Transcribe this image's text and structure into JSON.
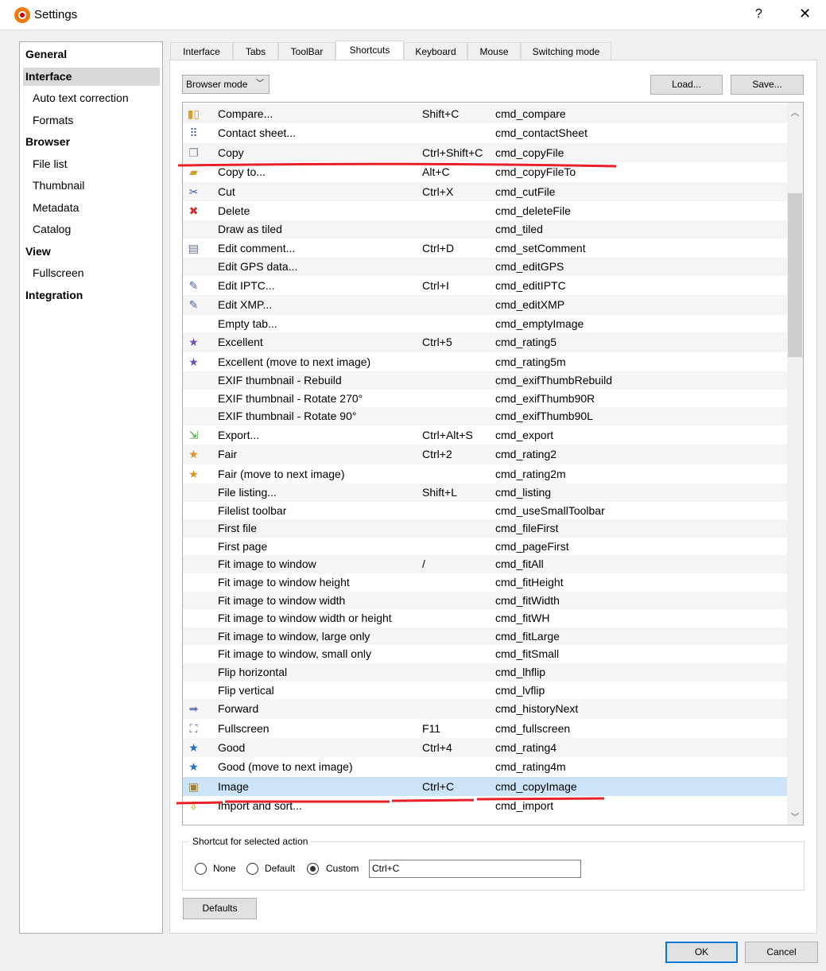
{
  "window": {
    "title": "Settings",
    "help": "?",
    "close": "✕"
  },
  "sidebar": {
    "items": [
      {
        "label": "General",
        "type": "h"
      },
      {
        "label": "Interface",
        "type": "h",
        "selected": true
      },
      {
        "label": "Auto text correction",
        "type": "s"
      },
      {
        "label": "Formats",
        "type": "s"
      },
      {
        "label": "Browser",
        "type": "h"
      },
      {
        "label": "File list",
        "type": "s"
      },
      {
        "label": "Thumbnail",
        "type": "s"
      },
      {
        "label": "Metadata",
        "type": "s"
      },
      {
        "label": "Catalog",
        "type": "s"
      },
      {
        "label": "View",
        "type": "h"
      },
      {
        "label": "Fullscreen",
        "type": "s"
      },
      {
        "label": "Integration",
        "type": "h"
      }
    ]
  },
  "tabs": [
    "Interface",
    "Tabs",
    "ToolBar",
    "Shortcuts",
    "Keyboard",
    "Mouse",
    "Switching mode"
  ],
  "active_tab": "Shortcuts",
  "mode_dropdown": {
    "value": "Browser mode"
  },
  "load_label": "Load...",
  "save_label": "Save...",
  "shortcuts": [
    {
      "name": "Compare...",
      "shortcut": "Shift+C",
      "command": "cmd_compare",
      "icon": "compare-icon",
      "glyph": "▮▯",
      "color": "#e0a020"
    },
    {
      "name": "Contact sheet...",
      "shortcut": "",
      "command": "cmd_contactSheet",
      "icon": "contact-sheet-icon",
      "glyph": "⠿",
      "color": "#5060b0"
    },
    {
      "name": "Copy",
      "shortcut": "Ctrl+Shift+C",
      "command": "cmd_copyFile",
      "icon": "copy-icon",
      "glyph": "❐",
      "color": "#8090a0"
    },
    {
      "name": "Copy to...",
      "shortcut": "Alt+C",
      "command": "cmd_copyFileTo",
      "icon": "copy-to-icon",
      "glyph": "▰",
      "color": "#d0a030"
    },
    {
      "name": "Cut",
      "shortcut": "Ctrl+X",
      "command": "cmd_cutFile",
      "icon": "scissors-icon",
      "glyph": "✂",
      "color": "#4060a0"
    },
    {
      "name": "Delete",
      "shortcut": "",
      "command": "cmd_deleteFile",
      "icon": "delete-icon",
      "glyph": "✖",
      "color": "#d03030"
    },
    {
      "name": "Draw as tiled",
      "shortcut": "",
      "command": "cmd_tiled",
      "icon": "",
      "glyph": "",
      "color": ""
    },
    {
      "name": "Edit comment...",
      "shortcut": "Ctrl+D",
      "command": "cmd_setComment",
      "icon": "comment-icon",
      "glyph": "▤",
      "color": "#6070a0"
    },
    {
      "name": "Edit GPS data...",
      "shortcut": "",
      "command": "cmd_editGPS",
      "icon": "",
      "glyph": "",
      "color": ""
    },
    {
      "name": "Edit IPTC...",
      "shortcut": "Ctrl+I",
      "command": "cmd_editIPTC",
      "icon": "edit-tag-icon",
      "glyph": "✎",
      "color": "#5060a0"
    },
    {
      "name": "Edit XMP...",
      "shortcut": "",
      "command": "cmd_editXMP",
      "icon": "edit-tag-icon",
      "glyph": "✎",
      "color": "#5060a0"
    },
    {
      "name": "Empty tab...",
      "shortcut": "",
      "command": "cmd_emptyImage",
      "icon": "",
      "glyph": "",
      "color": ""
    },
    {
      "name": "Excellent",
      "shortcut": "Ctrl+5",
      "command": "cmd_rating5",
      "icon": "star-icon",
      "glyph": "★",
      "color": "#7050c0"
    },
    {
      "name": "Excellent (move to next image)",
      "shortcut": "",
      "command": "cmd_rating5m",
      "icon": "star-icon",
      "glyph": "★",
      "color": "#7050c0"
    },
    {
      "name": "EXIF thumbnail - Rebuild",
      "shortcut": "",
      "command": "cmd_exifThumbRebuild",
      "icon": "",
      "glyph": "",
      "color": ""
    },
    {
      "name": "EXIF thumbnail - Rotate 270°",
      "shortcut": "",
      "command": "cmd_exifThumb90R",
      "icon": "",
      "glyph": "",
      "color": ""
    },
    {
      "name": "EXIF thumbnail - Rotate 90°",
      "shortcut": "",
      "command": "cmd_exifThumb90L",
      "icon": "",
      "glyph": "",
      "color": ""
    },
    {
      "name": "Export...",
      "shortcut": "Ctrl+Alt+S",
      "command": "cmd_export",
      "icon": "export-icon",
      "glyph": "⇲",
      "color": "#40a040"
    },
    {
      "name": "Fair",
      "shortcut": "Ctrl+2",
      "command": "cmd_rating2",
      "icon": "star-icon",
      "glyph": "★",
      "color": "#e09020"
    },
    {
      "name": "Fair (move to next image)",
      "shortcut": "",
      "command": "cmd_rating2m",
      "icon": "star-icon",
      "glyph": "★",
      "color": "#e09020"
    },
    {
      "name": "File listing...",
      "shortcut": "Shift+L",
      "command": "cmd_listing",
      "icon": "",
      "glyph": "",
      "color": ""
    },
    {
      "name": "Filelist toolbar",
      "shortcut": "",
      "command": "cmd_useSmallToolbar",
      "icon": "",
      "glyph": "",
      "color": ""
    },
    {
      "name": "First file",
      "shortcut": "",
      "command": "cmd_fileFirst",
      "icon": "",
      "glyph": "",
      "color": ""
    },
    {
      "name": "First page",
      "shortcut": "",
      "command": "cmd_pageFirst",
      "icon": "",
      "glyph": "",
      "color": ""
    },
    {
      "name": "Fit image to window",
      "shortcut": "/",
      "command": "cmd_fitAll",
      "icon": "",
      "glyph": "",
      "color": ""
    },
    {
      "name": "Fit image to window height",
      "shortcut": "",
      "command": "cmd_fitHeight",
      "icon": "",
      "glyph": "",
      "color": ""
    },
    {
      "name": "Fit image to window width",
      "shortcut": "",
      "command": "cmd_fitWidth",
      "icon": "",
      "glyph": "",
      "color": ""
    },
    {
      "name": "Fit image to window width or height",
      "shortcut": "",
      "command": "cmd_fitWH",
      "icon": "",
      "glyph": "",
      "color": ""
    },
    {
      "name": "Fit image to window, large only",
      "shortcut": "",
      "command": "cmd_fitLarge",
      "icon": "",
      "glyph": "",
      "color": ""
    },
    {
      "name": "Fit image to window, small only",
      "shortcut": "",
      "command": "cmd_fitSmall",
      "icon": "",
      "glyph": "",
      "color": ""
    },
    {
      "name": "Flip horizontal",
      "shortcut": "",
      "command": "cmd_lhflip",
      "icon": "",
      "glyph": "",
      "color": ""
    },
    {
      "name": "Flip vertical",
      "shortcut": "",
      "command": "cmd_lvflip",
      "icon": "",
      "glyph": "",
      "color": ""
    },
    {
      "name": "Forward",
      "shortcut": "",
      "command": "cmd_historyNext",
      "icon": "arrow-right-icon",
      "glyph": "➡",
      "color": "#7080c0"
    },
    {
      "name": "Fullscreen",
      "shortcut": "F11",
      "command": "cmd_fullscreen",
      "icon": "fullscreen-icon",
      "glyph": "⛶",
      "color": "#4050a0"
    },
    {
      "name": "Good",
      "shortcut": "Ctrl+4",
      "command": "cmd_rating4",
      "icon": "star-icon",
      "glyph": "★",
      "color": "#2070d0"
    },
    {
      "name": "Good (move to next image)",
      "shortcut": "",
      "command": "cmd_rating4m",
      "icon": "star-icon",
      "glyph": "★",
      "color": "#2070d0"
    },
    {
      "name": "Image",
      "shortcut": "Ctrl+C",
      "command": "cmd_copyImage",
      "icon": "image-icon",
      "glyph": "▣",
      "color": "#a08040",
      "selected": true
    },
    {
      "name": "Import and sort...",
      "shortcut": "",
      "command": "cmd_import",
      "icon": "import-icon",
      "glyph": "⇩",
      "color": "#d0a020"
    }
  ],
  "shortcut_group": {
    "legend": "Shortcut for selected action",
    "options": [
      "None",
      "Default",
      "Custom"
    ],
    "selected": "Custom",
    "value": "Ctrl+C"
  },
  "defaults_label": "Defaults",
  "ok_label": "OK",
  "cancel_label": "Cancel",
  "annotation_color": "#e8202a"
}
